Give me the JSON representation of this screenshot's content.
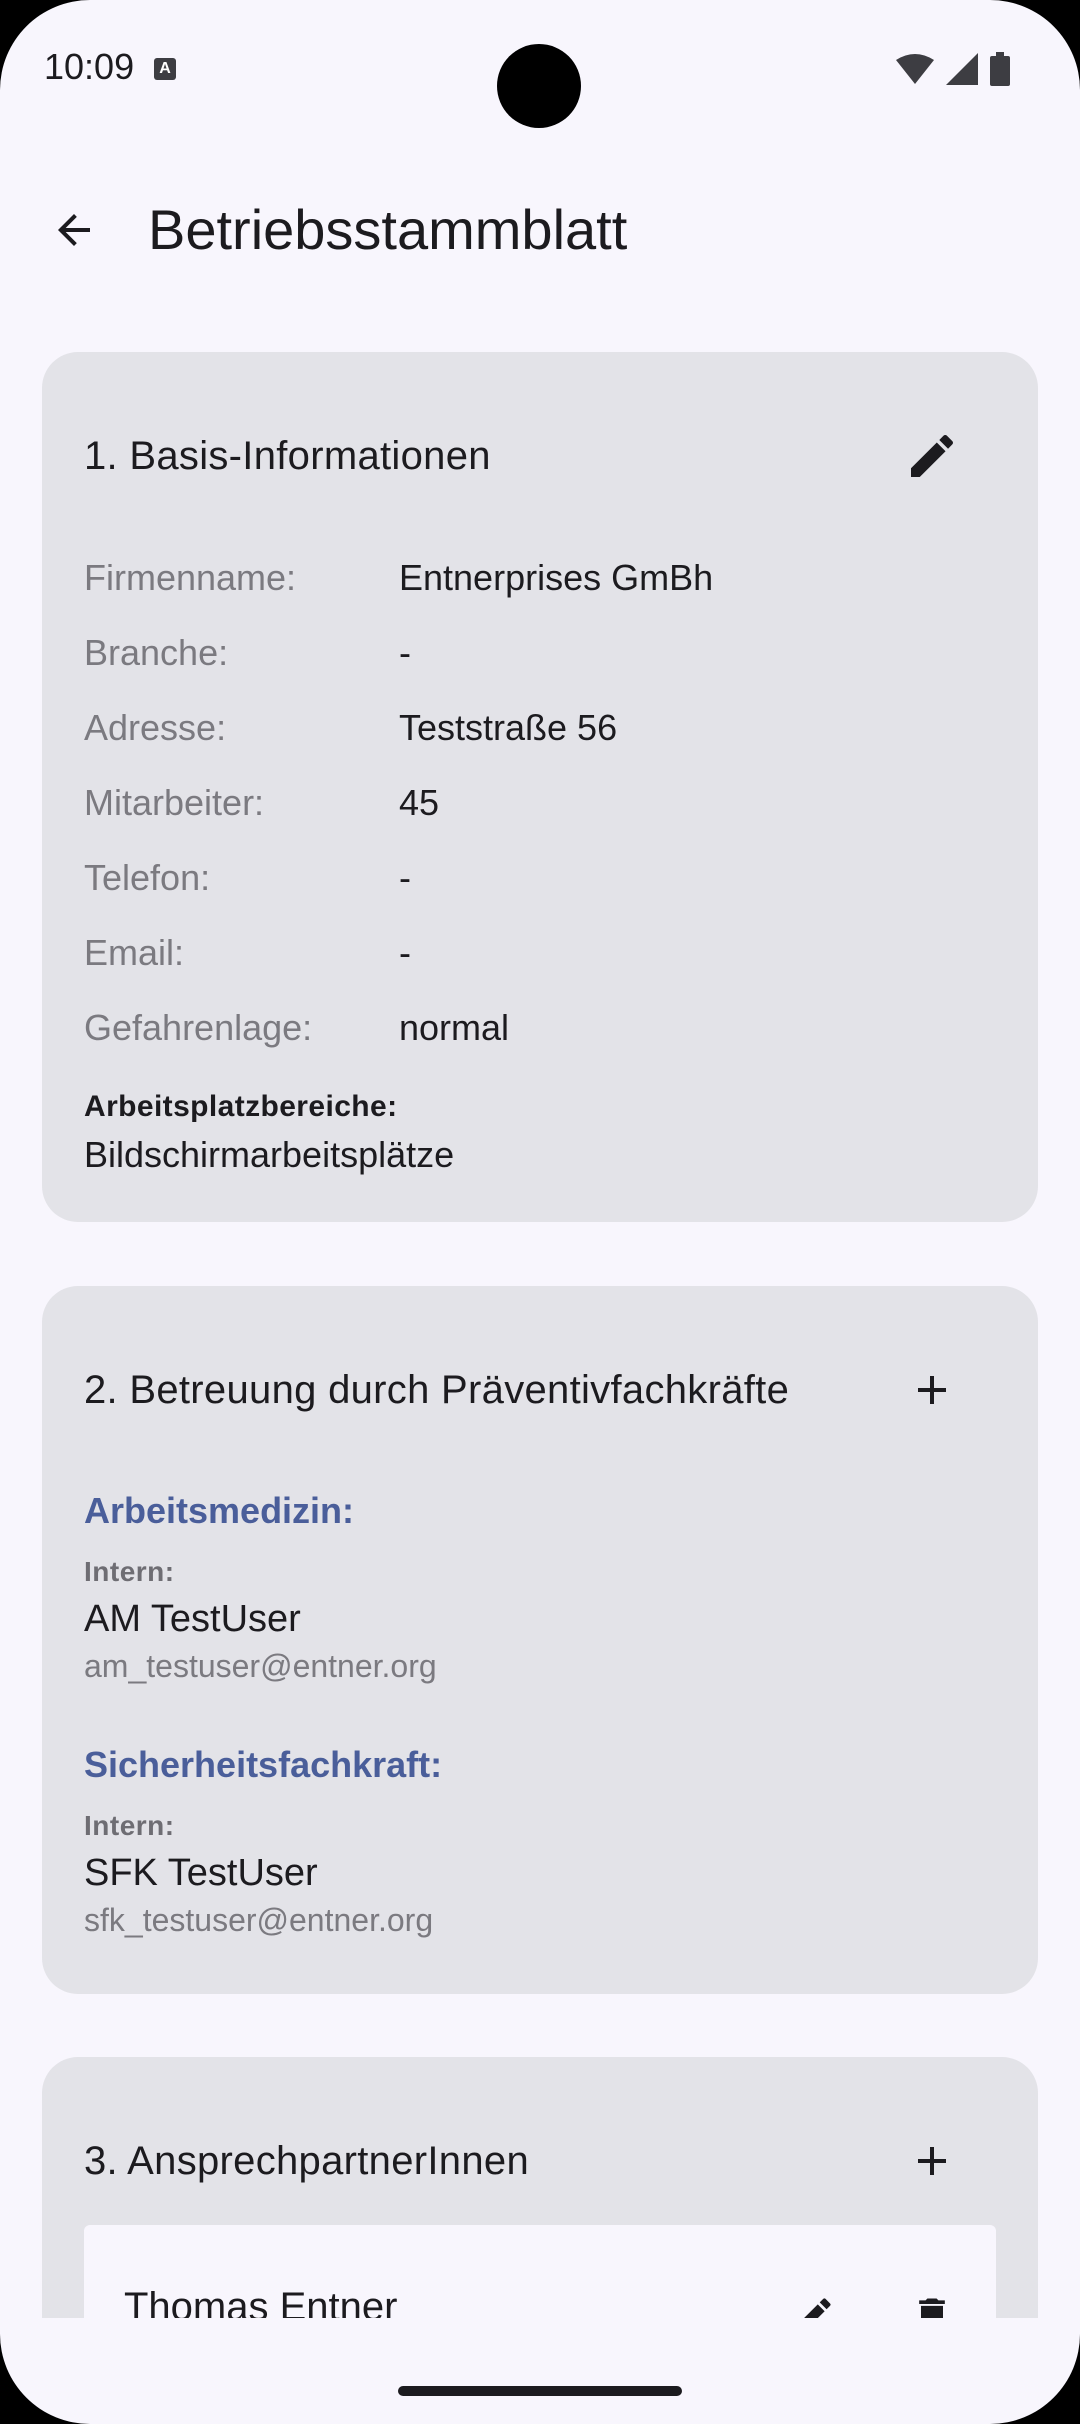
{
  "status_bar": {
    "time": "10:09",
    "notification_glyph": "A"
  },
  "app_bar": {
    "title": "Betriebsstammblatt"
  },
  "basis": {
    "title": "1. Basis-Informationen",
    "rows": [
      {
        "label": "Firmenname:",
        "value": "Entnerprises GmBh"
      },
      {
        "label": "Branche:",
        "value": "-"
      },
      {
        "label": "Adresse:",
        "value": "Teststraße 56"
      },
      {
        "label": "Mitarbeiter:",
        "value": "45"
      },
      {
        "label": "Telefon:",
        "value": "-"
      },
      {
        "label": "Email:",
        "value": "-"
      },
      {
        "label": "Gefahrenlage:",
        "value": "normal"
      }
    ],
    "areas_label": "Arbeitsplatzbereiche:",
    "areas_value": "Bildschirmarbeitsplätze"
  },
  "betreuung": {
    "title": "2. Betreuung durch Präventivfachkräfte",
    "groups": [
      {
        "heading": "Arbeitsmedizin:",
        "type": "Intern:",
        "name": "AM TestUser",
        "email": "am_testuser@entner.org"
      },
      {
        "heading": "Sicherheitsfachkraft:",
        "type": "Intern:",
        "name": "SFK TestUser",
        "email": "sfk_testuser@entner.org"
      }
    ]
  },
  "ansprechpartner": {
    "title": "3. AnsprechpartnerInnen",
    "contacts": [
      {
        "name": "Thomas Entner"
      }
    ]
  },
  "colors": {
    "accent": "#4a5e9a",
    "card": "#e3e3e8",
    "background": "#f8f6fd"
  }
}
